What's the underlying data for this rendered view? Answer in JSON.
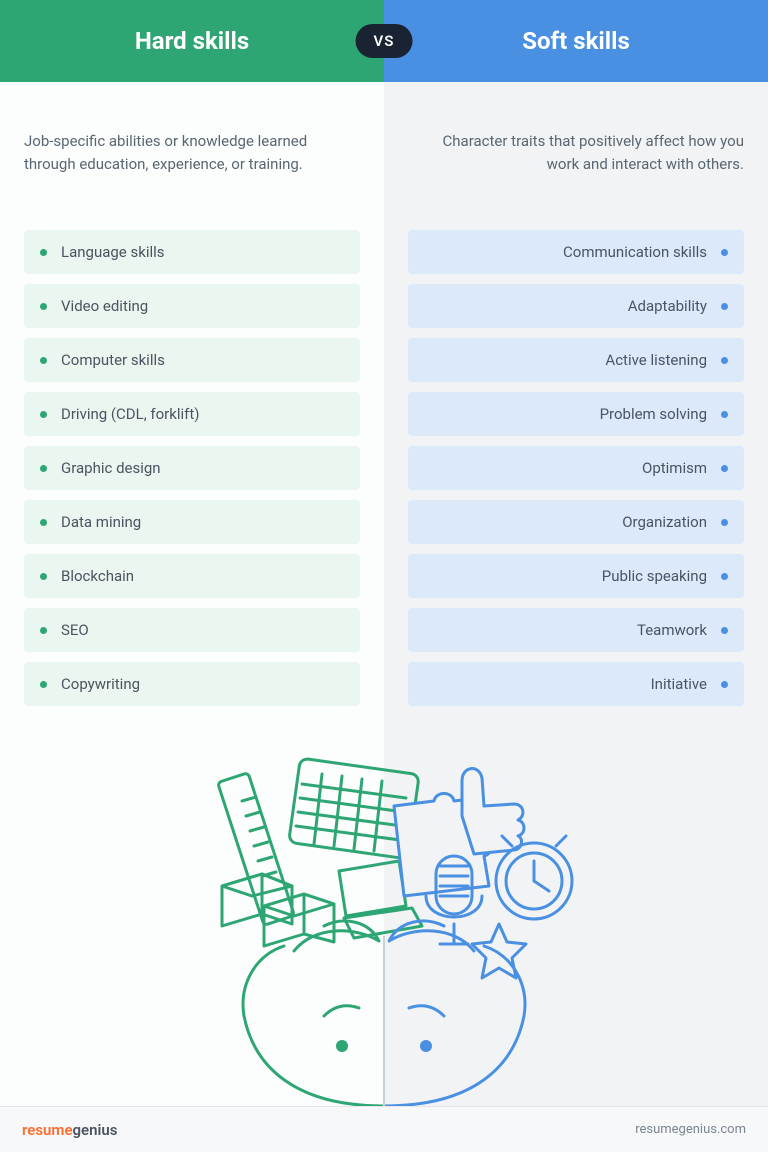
{
  "header": {
    "left_title": "Hard skills",
    "right_title": "Soft skills",
    "vs": "VS"
  },
  "left": {
    "description": "Job-specific abilities or knowledge learned through education, experience, or training.",
    "items": [
      "Language skills",
      "Video editing",
      "Computer skills",
      "Driving (CDL, forklift)",
      "Graphic design",
      "Data mining",
      "Blockchain",
      "SEO",
      "Copywriting"
    ]
  },
  "right": {
    "description": "Character traits that positively affect how you work and interact with others.",
    "items": [
      "Communication skills",
      "Adaptability",
      "Active listening",
      "Problem solving",
      "Optimism",
      "Organization",
      "Public speaking",
      "Teamwork",
      "Initiative"
    ]
  },
  "footer": {
    "brand_part1": "resume",
    "brand_part2": "genius",
    "url": "resumegenius.com"
  },
  "colors": {
    "green": "#2ea673",
    "blue": "#4a90e2"
  }
}
